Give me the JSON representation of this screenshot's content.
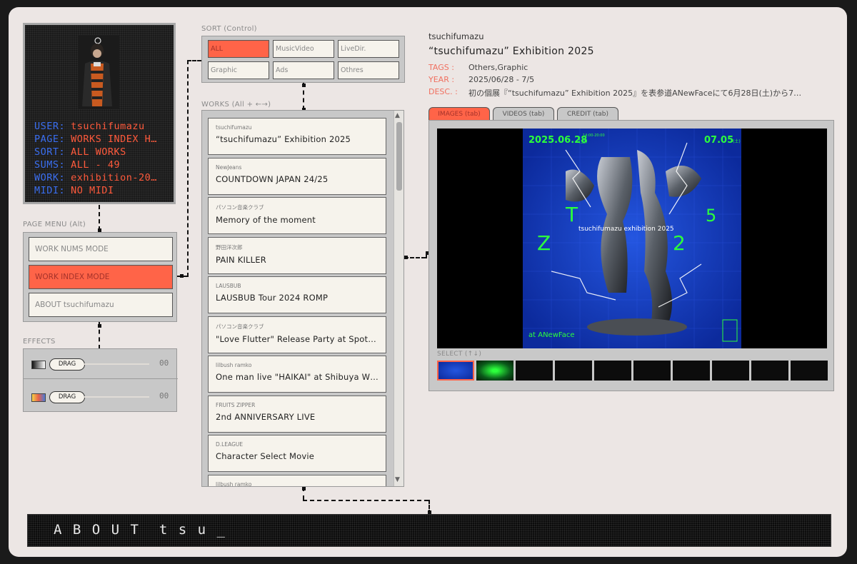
{
  "status": {
    "rows": [
      {
        "key": "USER:",
        "value": "tsuchifumazu"
      },
      {
        "key": "PAGE:",
        "value": "WORKS INDEX H…"
      },
      {
        "key": "SORT:",
        "value": "ALL WORKS"
      },
      {
        "key": "SUMS:",
        "value": "ALL - 49"
      },
      {
        "key": "WORK:",
        "value": "exhibition-20…"
      },
      {
        "key": "MIDI:",
        "value": "NO MIDI"
      }
    ]
  },
  "page_menu": {
    "label": "PAGE MENU (Alt)",
    "items": [
      {
        "label": "WORK NUMS MODE",
        "active": false
      },
      {
        "label": "WORK INDEX MODE",
        "active": true
      },
      {
        "label": "ABOUT tsuchifumazu",
        "active": false
      }
    ]
  },
  "effects": {
    "label": "EFFECTS",
    "items": [
      {
        "drag_label": "DRAG",
        "value": "00",
        "icon": "bw-gradient-icon"
      },
      {
        "drag_label": "DRAG",
        "value": "00",
        "icon": "color-gradient-icon"
      }
    ]
  },
  "sort": {
    "label": "SORT (Control)",
    "buttons": [
      {
        "label": "ALL",
        "active": true
      },
      {
        "label": "MusicVideo",
        "active": false
      },
      {
        "label": "LiveDir.",
        "active": false
      },
      {
        "label": "Graphic",
        "active": false
      },
      {
        "label": "Ads",
        "active": false
      },
      {
        "label": "Othres",
        "active": false
      }
    ]
  },
  "works": {
    "label": "WORKS (All + ←→)",
    "items": [
      {
        "artist": "tsuchifumazu",
        "title": "“tsuchifumazu” Exhibition 2025"
      },
      {
        "artist": "NewJeans",
        "title": "COUNTDOWN JAPAN 24/25"
      },
      {
        "artist": "パソコン音楽クラブ",
        "title": "Memory of the moment"
      },
      {
        "artist": "野田洋次郎",
        "title": "PAIN KILLER"
      },
      {
        "artist": "LAUSBUB",
        "title": "LAUSBUB Tour 2024 ROMP"
      },
      {
        "artist": "パソコン音楽クラブ",
        "title": "\"Love Flutter\" Release Party at Spotify O-EAST"
      },
      {
        "artist": "lilbush ramko",
        "title": "One man live \"HAIKAI\" at Shibuya WWW X"
      },
      {
        "artist": "FRUITS ZIPPER",
        "title": "2nd ANNIVERSARY LIVE"
      },
      {
        "artist": "D.LEAGUE",
        "title": "Character Select Movie"
      },
      {
        "artist": "lilbush ramko",
        "title": ""
      }
    ]
  },
  "detail": {
    "artist": "tsuchifumazu",
    "title": "“tsuchifumazu” Exhibition 2025",
    "tags_label": "TAGS :",
    "tags": "Others,Graphic",
    "year_label": "YEAR :",
    "year": "2025/06/28 - 7/5",
    "desc_label": "DESC. :",
    "desc": "初の個展『“tsuchifumazu” Exhibition 2025』を表参道ANewFaceにて6月28日(土)から7…",
    "tabs": [
      {
        "label": "IMAGES (tab)",
        "active": true
      },
      {
        "label": "VIDEOS (tab)",
        "active": false
      },
      {
        "label": "CREDIT (tab)",
        "active": false
      }
    ],
    "select_label": "SELECT (↑↓)",
    "poster": {
      "date_start": "2025.06.28",
      "date_start_sub": "(土)",
      "date_end": "07.05",
      "date_end_sub": "(土)",
      "time": "14:00-20:00",
      "title_line": "tsuchifumazu exhibition 2025",
      "big_glyphs": [
        "T",
        "Z",
        "2",
        "5"
      ],
      "venue": "at ANewFace",
      "corner_glyph": "土\n踏",
      "colors": {
        "bg": "#1840c8",
        "accent": "#2cff3c",
        "metal": "#8a9098"
      }
    },
    "thumb_count": 10
  },
  "about_bar": {
    "text": "A B O U T  t s u _"
  },
  "colors": {
    "accent": "#ff6448",
    "status_key": "#3b6ff0",
    "status_value": "#ff5a3c",
    "panel": "#c8c8c8",
    "card": "#f6f3ec"
  }
}
